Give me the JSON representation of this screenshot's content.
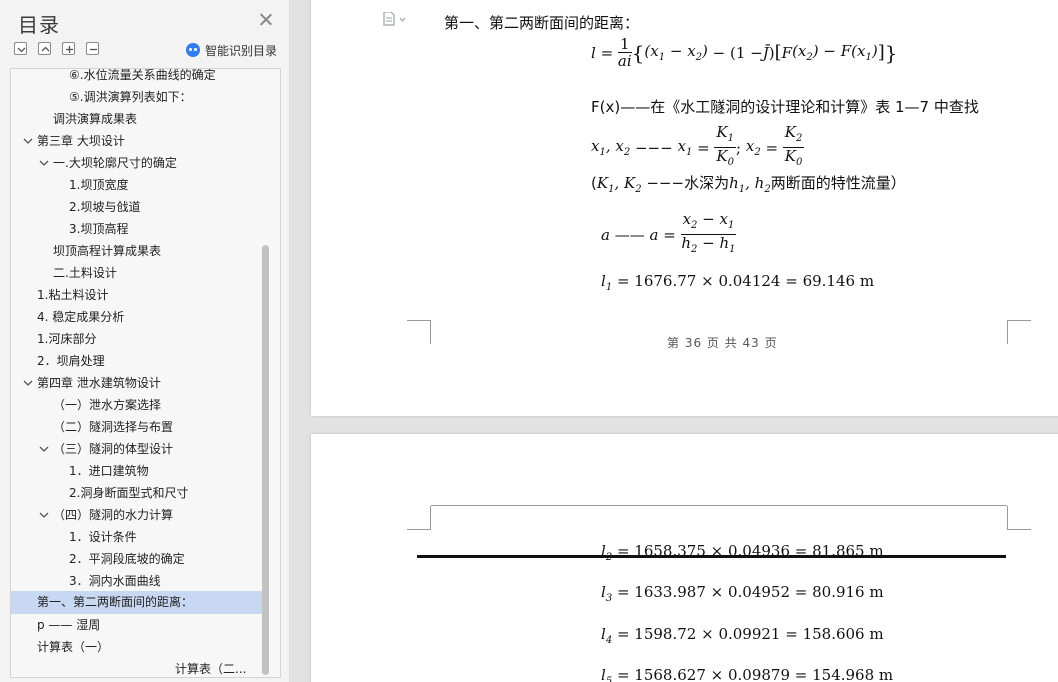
{
  "sidebar": {
    "title": "目录",
    "smart_toc_label": "智能识别目录",
    "items": [
      {
        "label": "⑥.水位流量关系曲线的确定",
        "chevron": "none"
      },
      {
        "label": "⑤.调洪演算列表如下：",
        "chevron": "none"
      },
      {
        "label": "调洪演算成果表",
        "chevron": "none"
      },
      {
        "label": "第三章   大坝设计",
        "chevron": "down"
      },
      {
        "label": "一.大坝轮廓尺寸的确定",
        "chevron": "down"
      },
      {
        "label": "1.坝顶宽度",
        "chevron": "none"
      },
      {
        "label": "2.坝坡与戗道",
        "chevron": "none"
      },
      {
        "label": "3.坝顶高程",
        "chevron": "none"
      },
      {
        "label": "坝顶高程计算成果表",
        "chevron": "none"
      },
      {
        "label": "二.土料设计",
        "chevron": "none"
      },
      {
        "label": "1.粘土料设计",
        "chevron": "none"
      },
      {
        "label": "4.   稳定成果分析",
        "chevron": "none"
      },
      {
        "label": "1.河床部分",
        "chevron": "none"
      },
      {
        "label": "2．坝肩处理",
        "chevron": "none"
      },
      {
        "label": "第四章      泄水建筑物设计",
        "chevron": "down"
      },
      {
        "label": "（一）泄水方案选择",
        "chevron": "none"
      },
      {
        "label": "（二）隧洞选择与布置",
        "chevron": "none"
      },
      {
        "label": "（三）隧洞的体型设计",
        "chevron": "down"
      },
      {
        "label": "1．进口建筑物",
        "chevron": "none"
      },
      {
        "label": "2.洞身断面型式和尺寸",
        "chevron": "none"
      },
      {
        "label": "（四）隧洞的水力计算",
        "chevron": "down"
      },
      {
        "label": "1．设计条件",
        "chevron": "none"
      },
      {
        "label": "2．平洞段底坡的确定",
        "chevron": "none"
      },
      {
        "label": "3．洞内水面曲线",
        "chevron": "none"
      },
      {
        "label": "第一、第二两断面间的距离：",
        "chevron": "none",
        "selected": true
      },
      {
        "label": "p ——  湿周",
        "chevron": "none"
      },
      {
        "label": "计算表（一）",
        "chevron": "none"
      },
      {
        "label": "计算表（二...",
        "chevron": "none"
      }
    ]
  },
  "document": {
    "heading": "第一、第二两断面间的距离：",
    "fx_line": "F(x)——在《水工隧洞的设计理论和计算》表 1—7 中查找",
    "k_line_text": "水深为",
    "k_line_suffix": "两断面的特性流量）",
    "page_footer": "第 36 页 共 43 页",
    "l1": "= 1676.77 × 0.04124 = 69.146 m",
    "l2": "= 1658.375 × 0.04936 = 81.865 m",
    "l3": "= 1633.987 × 0.04952 = 80.916 m",
    "l4": "= 1598.72 × 0.09921 = 158.606 m",
    "l5": "= 1568.627 × 0.09879 = 154.968 m"
  }
}
